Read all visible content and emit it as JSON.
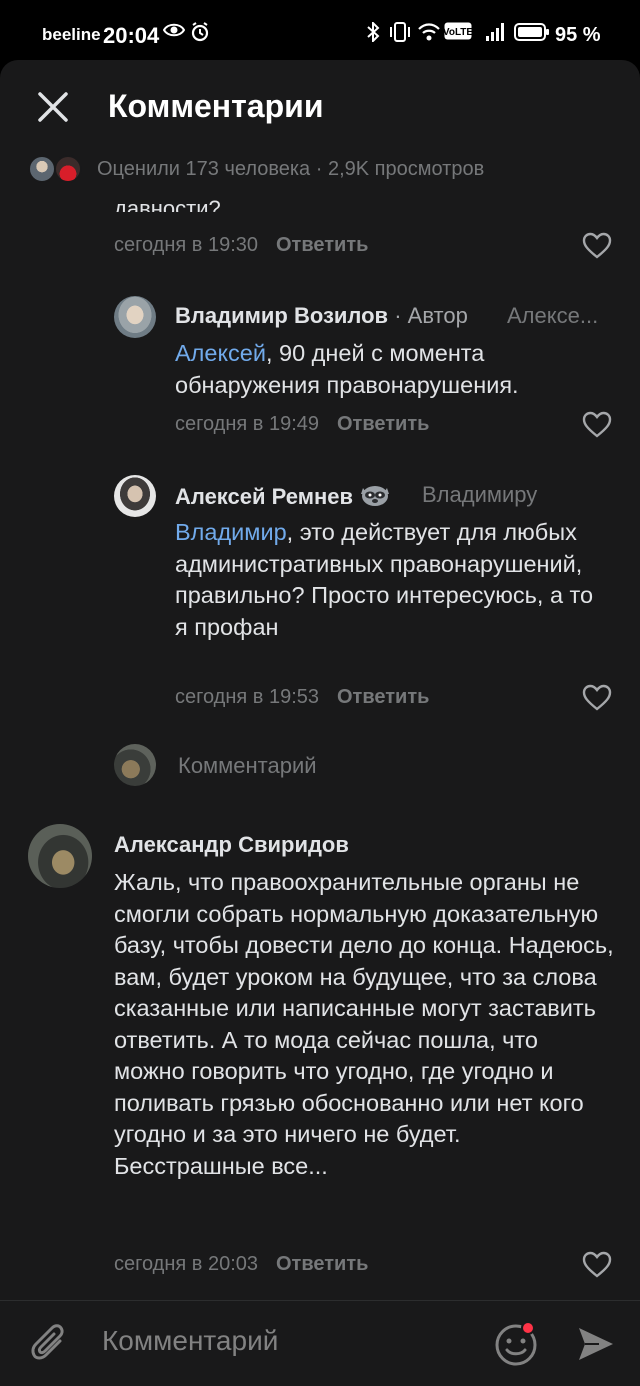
{
  "status_bar": {
    "carrier": "beeline",
    "time": "20:04",
    "battery": "95 %"
  },
  "header": {
    "title": "Комментарии"
  },
  "meta": {
    "text": "Оценили 173 человека · 2,9K просмотров"
  },
  "comments": {
    "cut": {
      "text": "давности?",
      "date": "сегодня в 19:30",
      "reply": "Ответить"
    },
    "c1": {
      "author": "Владимир Возилов",
      "author_badge": " · Автор",
      "reply_to": "Алексе...",
      "mention": "Алексей",
      "text": ", 90 дней с момента обнаружения правонарушения.",
      "date": "сегодня в 19:49",
      "reply": "Ответить"
    },
    "c2": {
      "author": "Алексей Ремнев",
      "reply_to": "Владимиру",
      "mention": "Владимир",
      "text": ", это действует для любых административных правонарушений, правильно? Просто интересуюсь, а то я профан",
      "date": "сегодня в 19:53",
      "reply": "Ответить"
    },
    "reply_input": {
      "placeholder": "Комментарий"
    },
    "c3": {
      "author": "Александр Свиридов",
      "text": "Жаль, что правоохранительные органы не смогли собрать нормальную доказательную базу, чтобы довести дело до конца. Надеюсь, вам, будет уроком на будущее, что за слова сказанные или написанные могут заставить ответить. А то мода сейчас пошла, что можно говорить что угодно, где угодно и поливать грязью обоснованно или нет кого угодно и за это ничего не будет. Бесстрашные все...",
      "date": "сегодня в 20:03",
      "reply": "Ответить"
    }
  },
  "bottom_bar": {
    "placeholder": "Комментарий"
  },
  "colors": {
    "background": "#19191a",
    "accent": "#71aaeb",
    "muted": "#76787a",
    "notification_dot": "#ff3347"
  }
}
